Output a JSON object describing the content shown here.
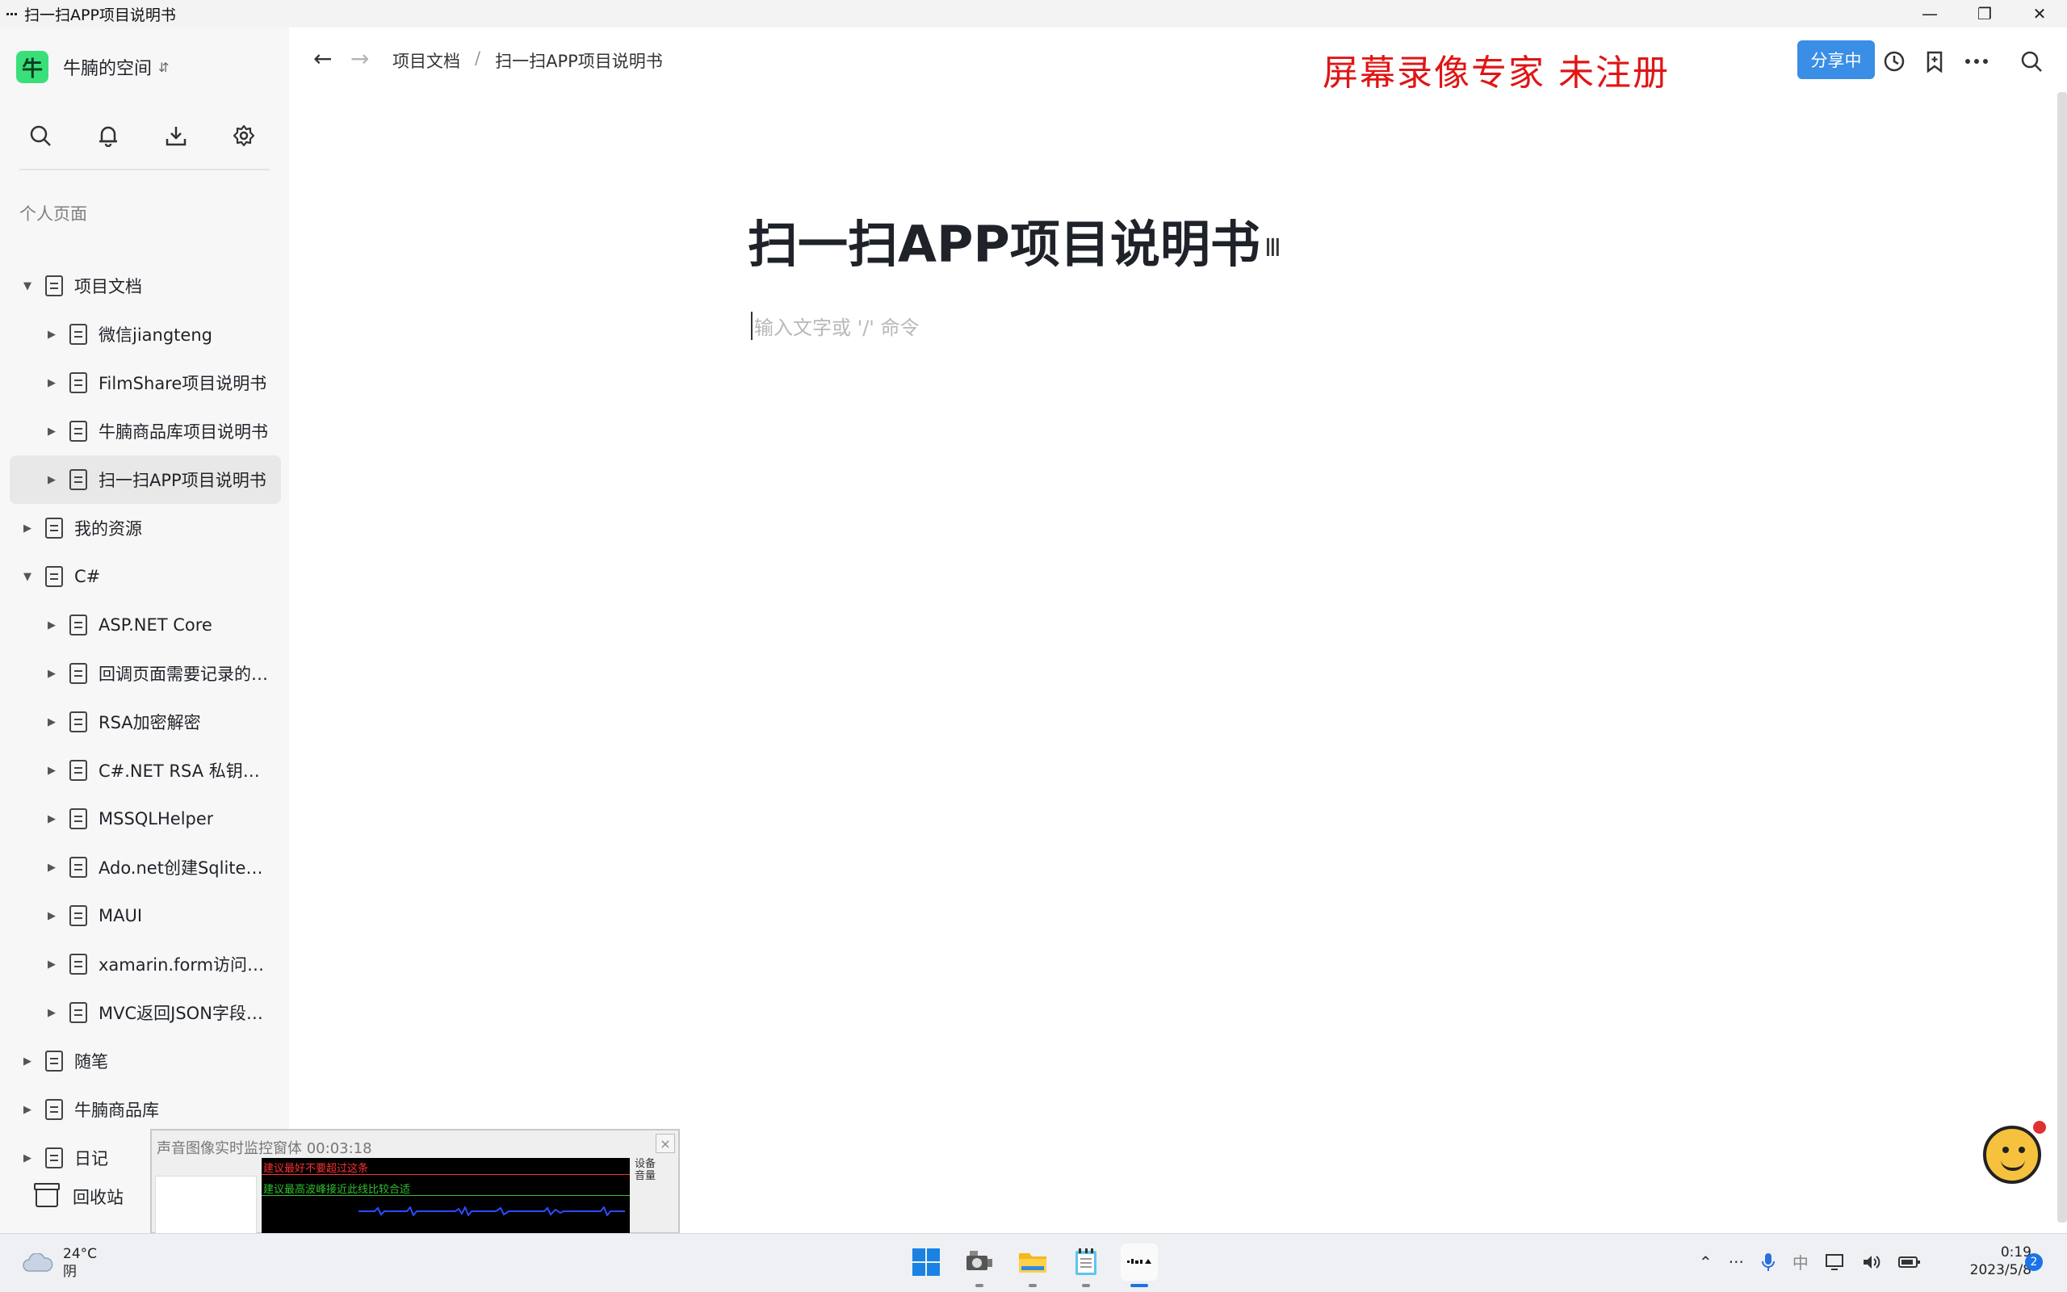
{
  "window": {
    "title": "扫一扫APP项目说明书"
  },
  "sidebar": {
    "space_name": "牛腩的空间",
    "space_logo": "牛",
    "section_label": "个人页面",
    "items": [
      {
        "label": "项目文档",
        "level": 0,
        "expanded": true
      },
      {
        "label": "微信jiangteng",
        "level": 1,
        "expanded": false
      },
      {
        "label": "FilmShare项目说明书",
        "level": 1,
        "expanded": false
      },
      {
        "label": "牛腩商品库项目说明书",
        "level": 1,
        "expanded": false
      },
      {
        "label": "扫一扫APP项目说明书",
        "level": 1,
        "expanded": false,
        "selected": true
      },
      {
        "label": "我的资源",
        "level": 0,
        "expanded": false
      },
      {
        "label": "C#",
        "level": 0,
        "expanded": true
      },
      {
        "label": "ASP.NET Core",
        "level": 1,
        "expanded": false
      },
      {
        "label": "回调页面需要记录的…",
        "level": 1,
        "expanded": false
      },
      {
        "label": "RSA加密解密",
        "level": 1,
        "expanded": false
      },
      {
        "label": "C#.NET RSA 私钥签…",
        "level": 1,
        "expanded": false
      },
      {
        "label": "MSSQLHelper",
        "level": 1,
        "expanded": false
      },
      {
        "label": "Ado.net创建Sqlite数…",
        "level": 1,
        "expanded": false
      },
      {
        "label": "MAUI",
        "level": 1,
        "expanded": false
      },
      {
        "label": "xamarin.form访问网…",
        "level": 1,
        "expanded": false
      },
      {
        "label": "MVC返回JSON字段…",
        "level": 1,
        "expanded": false
      },
      {
        "label": "随笔",
        "level": 0,
        "expanded": false
      },
      {
        "label": "牛腩商品库",
        "level": 0,
        "expanded": false
      },
      {
        "label": "日记",
        "level": 0,
        "expanded": false
      }
    ],
    "trash_label": "回收站"
  },
  "header": {
    "breadcrumb": [
      "项目文档",
      "扫一扫APP项目说明书"
    ],
    "breadcrumb_sep": "/",
    "watermark": "屏幕录像专家  未注册",
    "share_label": "分享中",
    "share_color": "#3a8ee6"
  },
  "document": {
    "title": "扫一扫APP项目说明书",
    "placeholder": "输入文字或 '/' 命令"
  },
  "monitor": {
    "title": "声音图像实时监控窗体 00:03:18",
    "red_hint": "建议最好不要超过这条",
    "green_hint": "建议最高波峰接近此线比较合适",
    "volume_label_1": "设备",
    "volume_label_2": "音量"
  },
  "taskbar": {
    "temperature": "24°C",
    "weather": "阴",
    "time": "0:19",
    "date": "2023/5/8",
    "notifications": "2"
  }
}
